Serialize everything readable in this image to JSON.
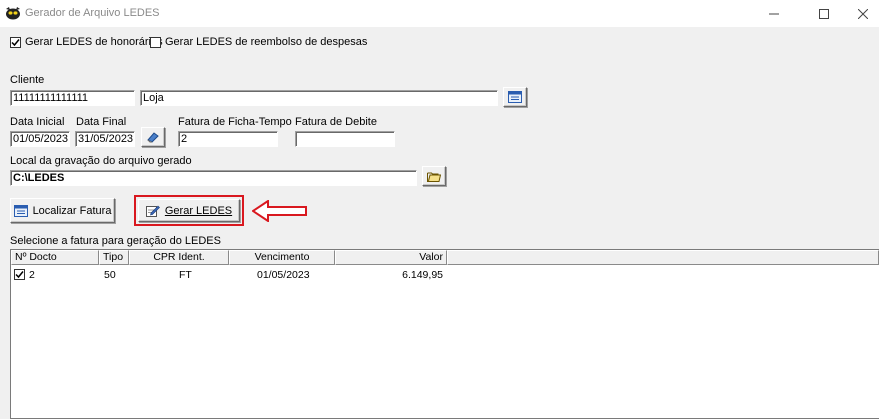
{
  "window": {
    "title": "Gerador de Arquivo LEDES",
    "minimize": "—",
    "maximize": "☐",
    "close": "✕"
  },
  "options": {
    "honorarios_label": "Gerar LEDES de honorários",
    "honorarios_checked": true,
    "reembolso_label": "Gerar LEDES de reembolso de despesas",
    "reembolso_checked": false
  },
  "cliente": {
    "label": "Cliente",
    "code": "11111111111111",
    "name": "Loja"
  },
  "periodo": {
    "inicial_label": "Data Inicial",
    "inicial_value": "01/05/2023",
    "final_label": "Data Final",
    "final_value": "31/05/2023"
  },
  "fatura": {
    "ficha_label": "Fatura de Ficha-Tempo",
    "ficha_value": "2",
    "debite_label": "Fatura de Debite",
    "debite_value": ""
  },
  "local": {
    "label": "Local da gravação do arquivo gerado",
    "path": "C:\\LEDES"
  },
  "buttons": {
    "localizar": "Localizar Fatura",
    "gerar": "Gerar LEDES"
  },
  "grid": {
    "caption": "Selecione a fatura para geração do LEDES",
    "columns": [
      "Nº Docto",
      "Tipo",
      "CPR Ident.",
      "Vencimento",
      "Valor"
    ],
    "rows": [
      {
        "checked": true,
        "docto": "2",
        "tipo": "50",
        "cpr": "FT",
        "vencimento": "01/05/2023",
        "valor": "6.149,95"
      }
    ]
  },
  "colors": {
    "highlight": "#d9181f",
    "arrow": "#d9181f"
  }
}
